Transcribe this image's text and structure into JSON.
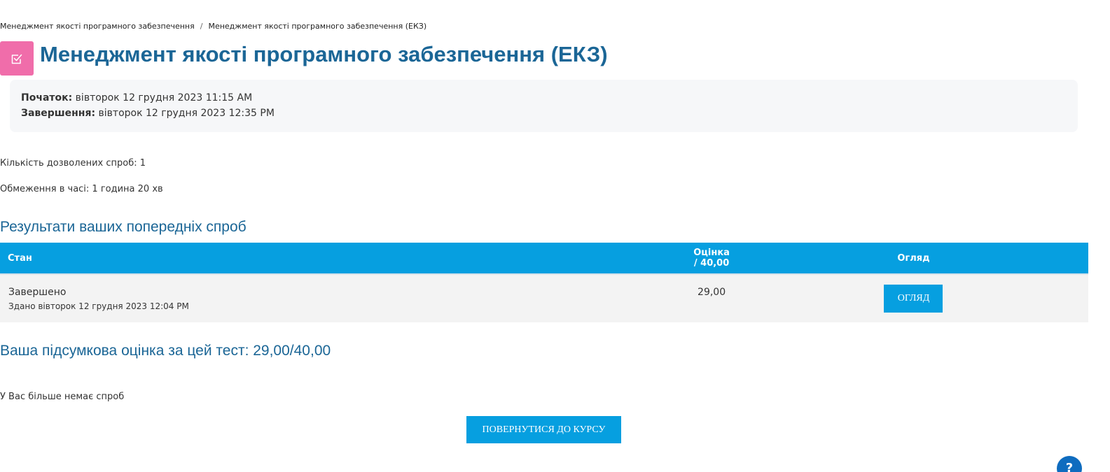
{
  "breadcrumb": {
    "items": [
      "Менеджмент якості програмного забезпечення",
      "Менеджмент якості програмного забезпечення (ЕКЗ)"
    ],
    "separator": "/"
  },
  "page": {
    "title": "Менеджмент якості програмного забезпечення (ЕКЗ)",
    "icon": "quiz-checkbox-icon",
    "icon_color": "#f06daa",
    "title_color": "#1b6696"
  },
  "dates": {
    "start_label": "Початок:",
    "start_value": " вівторок 12 грудня 2023 11:15 AM",
    "end_label": "Завершення:",
    "end_value": " вівторок 12 грудня 2023 12:35 PM"
  },
  "info": {
    "attempts_allowed": "Кількість дозволених спроб: 1",
    "time_limit": "Обмеження в часі: 1 година 20 хв"
  },
  "results": {
    "heading": "Результати ваших попередніх спроб",
    "columns": [
      "Стан",
      "Оцінка / 40,00",
      "Огляд"
    ],
    "rows": [
      {
        "state": "Завершено",
        "submitted": "Здано вівторок 12 грудня 2023 12:04 PM",
        "grade": "29,00",
        "review_label": "ОГЛЯД"
      }
    ],
    "header_color": "#069fe0"
  },
  "final_grade": "Ваша підсумкова оцінка за цей тест: 29,00/40,00",
  "no_more_attempts": "У Вас більше немає спроб",
  "back_button": "ПОВЕРНУТИСЯ ДО КУРСУ",
  "help_button": "?",
  "accent_color": "#069fe0"
}
